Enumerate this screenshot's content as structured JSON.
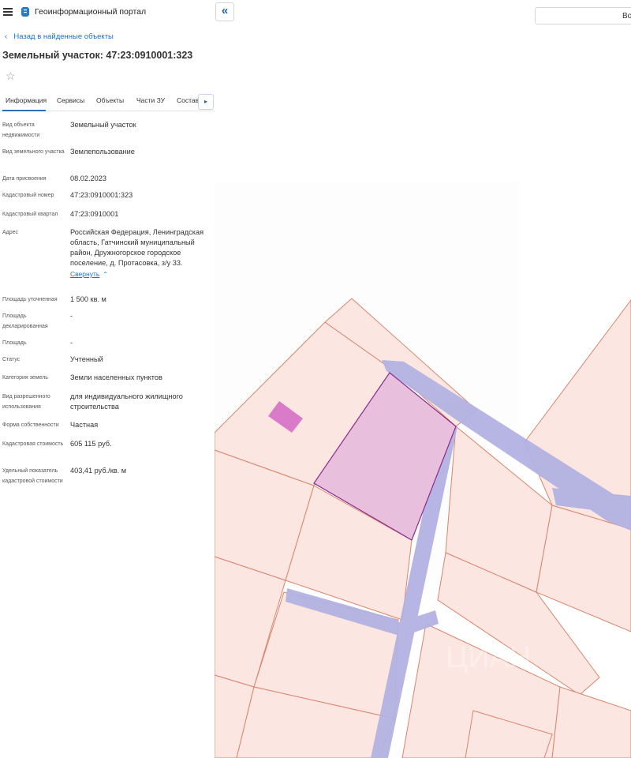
{
  "header": {
    "app_title": "Геоинформационный портал",
    "menu_icon": "hamburger-icon",
    "logo_icon": "document-logo-icon"
  },
  "navigation": {
    "back_label": "Назад в найденные объекты",
    "collapse_panel": "«"
  },
  "object": {
    "title": "Земельный участок: 47:23:0910001:323"
  },
  "tabs": [
    {
      "label": "Информация",
      "active": true
    },
    {
      "label": "Сервисы"
    },
    {
      "label": "Объекты"
    },
    {
      "label": "Части ЗУ"
    },
    {
      "label": "Состав"
    }
  ],
  "tabs_next_icon": "▸",
  "properties": [
    {
      "label": "Вид объекта недвижимости",
      "value": "Земельный участок"
    },
    {
      "label": "Вид земельного участка",
      "value": "Землепользование"
    },
    {
      "label": "Дата присвоения",
      "value": "08.02.2023"
    },
    {
      "label": "Кадастровый номер",
      "value": "47:23:0910001:323"
    },
    {
      "label": "Кадастровый квартал",
      "value": "47:23:0910001"
    },
    {
      "label": "Адрес",
      "value": "Российская Федерация, Ленинградская область, Гатчинский муниципальный район, Дружногорское городское поселение, д. Протасовка, з/у 33.",
      "link": "Свернуть"
    },
    {
      "label": "Площадь уточненная",
      "value": "1 500 кв. м"
    },
    {
      "label": "Площадь декларированная",
      "value": "-"
    },
    {
      "label": "Площадь",
      "value": "-"
    },
    {
      "label": "Статус",
      "value": "Учтенный"
    },
    {
      "label": "Категория земель",
      "value": "Земли населенных пунктов"
    },
    {
      "label": "Вид разрешенного использования",
      "value": "для индивидуального жилищного строительства"
    },
    {
      "label": "Форма собственности",
      "value": "Частная"
    },
    {
      "label": "Кадастровая стоимость",
      "value": "605 115 руб."
    },
    {
      "label": "Удельный показатель кадастровой стоимости",
      "value": "403,41 руб./кв. м"
    }
  ],
  "search": {
    "partial_label": "Во"
  },
  "colors": {
    "parcel_fill": "#fbe6e1",
    "parcel_border": "#d9856c",
    "selected_fill": "#e8bfdc",
    "selected_border": "#8a2a8a",
    "building_fill": "#d97bc8",
    "road_fill": "#b3b2e2",
    "link": "#1a73c9"
  },
  "watermark": "ЦИАН"
}
